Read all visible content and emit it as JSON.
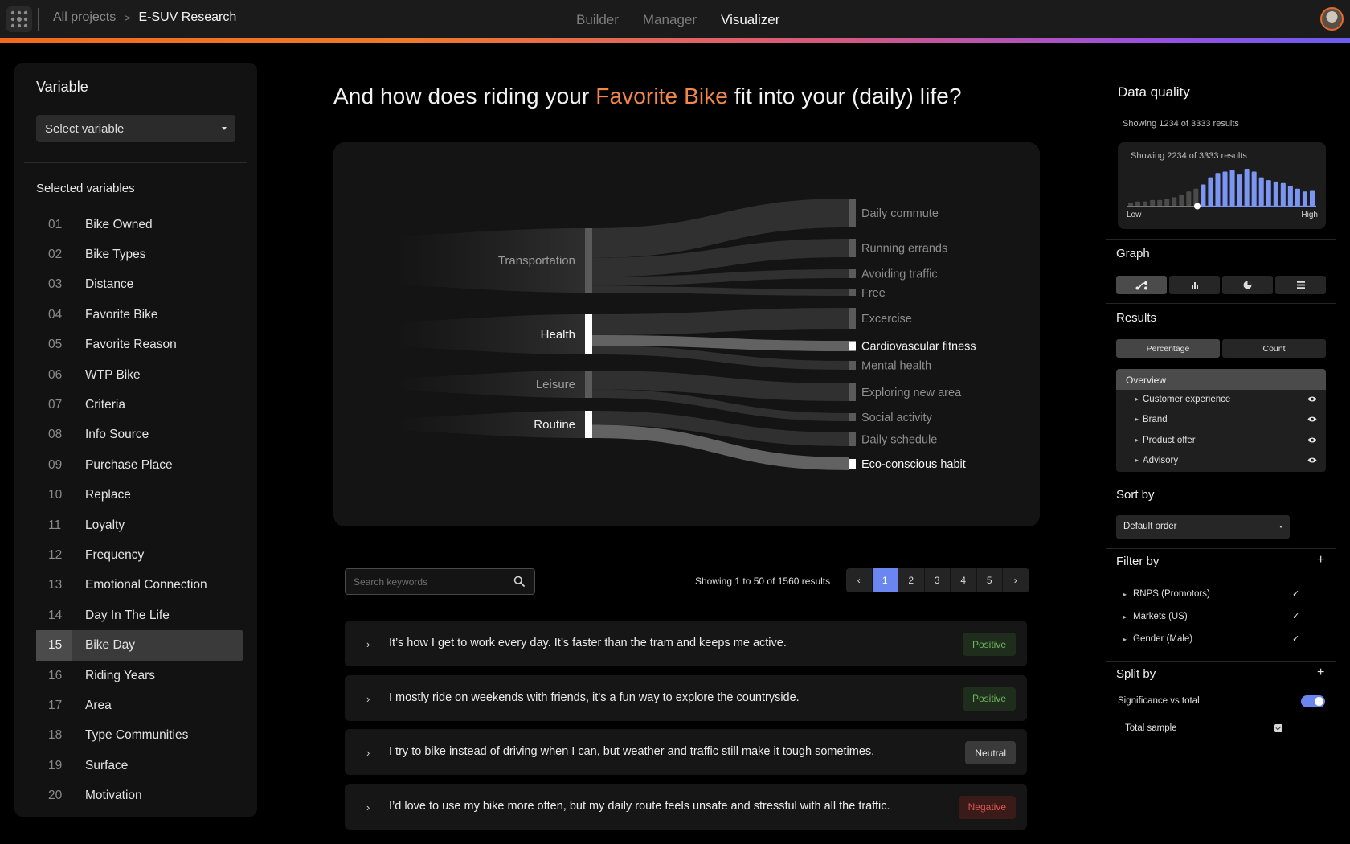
{
  "header": {
    "breadcrumb_root": "All projects",
    "breadcrumb_sep": ">",
    "breadcrumb_current": "E-SUV Research",
    "nav": [
      {
        "label": "Builder",
        "active": false
      },
      {
        "label": "Manager",
        "active": false
      },
      {
        "label": "Visualizer",
        "active": true
      }
    ],
    "accent_gradient": [
      "#f26a1f",
      "#d95a7a",
      "#6c5cf0"
    ]
  },
  "left": {
    "title": "Variable",
    "select_placeholder": "Select variable",
    "selected_title": "Selected variables",
    "variables": [
      {
        "num": "01",
        "label": "Bike Owned"
      },
      {
        "num": "02",
        "label": "Bike Types"
      },
      {
        "num": "03",
        "label": "Distance"
      },
      {
        "num": "04",
        "label": "Favorite Bike"
      },
      {
        "num": "05",
        "label": "Favorite Reason"
      },
      {
        "num": "06",
        "label": "WTP Bike"
      },
      {
        "num": "07",
        "label": "Criteria"
      },
      {
        "num": "08",
        "label": "Info Source"
      },
      {
        "num": "09",
        "label": "Purchase Place"
      },
      {
        "num": "10",
        "label": "Replace"
      },
      {
        "num": "11",
        "label": "Loyalty"
      },
      {
        "num": "12",
        "label": "Frequency"
      },
      {
        "num": "13",
        "label": "Emotional Connection"
      },
      {
        "num": "14",
        "label": "Day In The Life"
      },
      {
        "num": "15",
        "label": "Bike Day"
      },
      {
        "num": "16",
        "label": "Riding Years"
      },
      {
        "num": "17",
        "label": "Area"
      },
      {
        "num": "18",
        "label": "Type Communities"
      },
      {
        "num": "19",
        "label": "Surface"
      },
      {
        "num": "20",
        "label": "Motivation"
      }
    ],
    "active_index": 14
  },
  "main": {
    "question_pre": "And how does riding your ",
    "question_highlight": "Favorite Bike",
    "question_post": " fit into your (daily) life?",
    "highlight_color": "#f2874a",
    "search_placeholder": "Search keywords",
    "showing": "Showing 1 to 50 of 1560 results",
    "pages": [
      "‹",
      "1",
      "2",
      "3",
      "4",
      "5",
      "›"
    ],
    "active_page": "1",
    "responses": [
      {
        "text": "It’s how I get to work every day. It’s faster than the tram and keeps me active.",
        "sentiment": "Positive",
        "kind": "pos"
      },
      {
        "text": "I mostly ride on weekends with friends, it’s a fun way to explore the countryside.",
        "sentiment": "Positive",
        "kind": "pos"
      },
      {
        "text": "I try to bike instead of driving when I can, but weather and traffic still make it tough sometimes.",
        "sentiment": "Neutral",
        "kind": "neu"
      },
      {
        "text": "I’d love to use my bike more often, but my daily route feels unsafe and stressful with all the traffic.",
        "sentiment": "Negative",
        "kind": "neg"
      }
    ]
  },
  "sankey": {
    "categories": [
      {
        "label": "Transportation",
        "highlight": false
      },
      {
        "label": "Health",
        "highlight": true
      },
      {
        "label": "Leisure",
        "highlight": false
      },
      {
        "label": "Routine",
        "highlight": true
      }
    ],
    "outcomes": [
      {
        "label": "Daily commute",
        "highlight": false
      },
      {
        "label": "Running errands",
        "highlight": false
      },
      {
        "label": "Avoiding traffic",
        "highlight": false
      },
      {
        "label": "Free",
        "highlight": false
      },
      {
        "label": "Excercise",
        "highlight": false
      },
      {
        "label": "Cardiovascular fitness",
        "highlight": true
      },
      {
        "label": "Mental health",
        "highlight": false
      },
      {
        "label": "Exploring new area",
        "highlight": false
      },
      {
        "label": "Social activity",
        "highlight": false
      },
      {
        "label": "Daily schedule",
        "highlight": false
      },
      {
        "label": "Eco-conscious habit",
        "highlight": true
      }
    ]
  },
  "right": {
    "dq_title": "Data quality",
    "dq_showing_outer": "Showing 1234 of 3333 results",
    "dq_showing_inner": "Showing 2234 of 3333 results",
    "dq_low": "Low",
    "dq_high": "High",
    "dq_bars": [
      2,
      3,
      3,
      4,
      4,
      5,
      6,
      8,
      10,
      12,
      15,
      20,
      23,
      24,
      25,
      22,
      26,
      24,
      20,
      18,
      17,
      16,
      14,
      12,
      10,
      11
    ],
    "dq_slider_fraction": 0.37,
    "dq_active_color": "#7b95f3",
    "graph_title": "Graph",
    "graph_types": [
      "sankey-icon",
      "bar-chart-icon",
      "pie-chart-icon",
      "list-icon"
    ],
    "results_title": "Results",
    "results_modes": [
      {
        "label": "Percentage",
        "active": true
      },
      {
        "label": "Count",
        "active": false
      }
    ],
    "overview": "Overview",
    "overview_items": [
      "Customer experience",
      "Brand",
      "Product offer",
      "Advisory"
    ],
    "sort_title": "Sort by",
    "sort_value": "Default order",
    "filter_title": "Filter by",
    "filters": [
      "RNPS (Promotors)",
      "Markets (US)",
      "Gender (Male)"
    ],
    "split_title": "Split by",
    "significance_label": "Significance vs total",
    "significance_on": true,
    "total_sample": "Total sample",
    "plus": "+",
    "check": "✓"
  }
}
